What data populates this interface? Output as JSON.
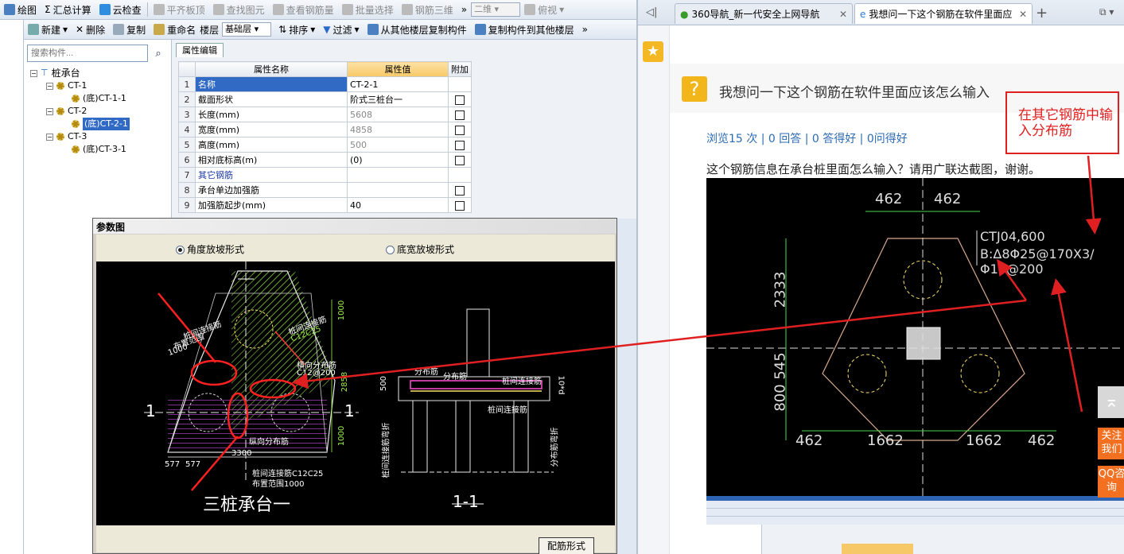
{
  "toolbar1": {
    "items": [
      "绘图",
      "汇总计算",
      "云检查",
      "平齐板顶",
      "查找图元",
      "查看钢筋量",
      "批量选择",
      "钢筋三维"
    ],
    "view_select": "二维",
    "view_mode": "俯视",
    "more": "»"
  },
  "toolbar2": {
    "new": "新建",
    "delete": "删除",
    "copy": "复制",
    "rename": "重命名",
    "floor_label": "楼层",
    "floor_value": "基础层",
    "sort": "排序",
    "filter": "过滤",
    "copy_from": "从其他楼层复制构件",
    "copy_to": "复制构件到其他楼层",
    "more": "»"
  },
  "tree": {
    "search_placeholder": "搜索构件...",
    "root": "桩承台",
    "items": [
      "CT-1",
      "(底)CT-1-1",
      "CT-2",
      "(底)CT-2-1",
      "CT-3",
      "(底)CT-3-1"
    ]
  },
  "props": {
    "tab": "属性编辑",
    "headers": [
      "属性名称",
      "属性值",
      "附加"
    ],
    "rows": [
      {
        "n": "1",
        "name": "名称",
        "value": "CT-2-1"
      },
      {
        "n": "2",
        "name": "截面形状",
        "value": "阶式三桩台一"
      },
      {
        "n": "3",
        "name": "长度(mm)",
        "value": "5608"
      },
      {
        "n": "4",
        "name": "宽度(mm)",
        "value": "4858"
      },
      {
        "n": "5",
        "name": "高度(mm)",
        "value": "500"
      },
      {
        "n": "6",
        "name": "相对底标高(m)",
        "value": "(0)"
      },
      {
        "n": "7",
        "name": "其它钢筋",
        "value": ""
      },
      {
        "n": "8",
        "name": "承台单边加强筋",
        "value": ""
      },
      {
        "n": "9",
        "name": "加强筋起步(mm)",
        "value": "40"
      }
    ]
  },
  "dialog": {
    "title": "参数图",
    "radio1": "角度放坡形式",
    "radio2": "底宽放坡形式",
    "button": "配筋形式",
    "labels": {
      "left_one": "1",
      "right_one": "1",
      "caption": "三桩承台一",
      "section": "1-1",
      "pile_conn": "桩间连接筋",
      "c12c25": "C12C25",
      "range": "布置范围",
      "range1000": "1000",
      "heng": "横向分布筋",
      "c12200": "C12@200",
      "zong": "纵向分布筋",
      "dim3300": "3300",
      "d577a": "577",
      "d577b": "577",
      "bot_conn": "桩间连接筋C12C25",
      "bot_range": "布置范围1000",
      "fenbu1": "分布筋",
      "fenbu2": "分布筋",
      "pile_conn2": "桩间连接筋",
      "pile_conn3": "桩间连接筋",
      "d500": "500",
      "d10d": "10*d",
      "vert_left": "桩间连接筋弯折",
      "vert_right": "分布筋弯折",
      "d2858": "2858",
      "d1000a": "1000",
      "d1000b": "1000"
    }
  },
  "browser": {
    "tabs": [
      "360导航_新一代安全上网导航",
      "我想问一下这个钢筋在软件里面应该"
    ],
    "question_title": "我想问一下这个钢筋在软件里面应该怎么输入",
    "stats": "浏览15 次 | 0 回答 | 0 答得好 | 0问得好",
    "body": "这个钢筋信息在承台桩里面怎么输入？请用广联达截图，谢谢。",
    "annotation": "在其它钢筋中输入分布筋",
    "follow": "关注我们",
    "qq": "QQ咨询",
    "photo_labels": {
      "d462a": "462",
      "d462b": "462",
      "ctj": "CTJ04,600",
      "rebar": "B:Δ8Φ25@170X3/Φ10@200",
      "d2333": "2333",
      "d545": "545",
      "d800": "800",
      "b462a": "462",
      "b1662a": "1662",
      "b1662b": "1662",
      "b462b": "462"
    }
  },
  "colors": {
    "accent": "#316ac5",
    "annotation_red": "#e02020",
    "header_gold": "#f7c867",
    "orange": "#f37021"
  }
}
